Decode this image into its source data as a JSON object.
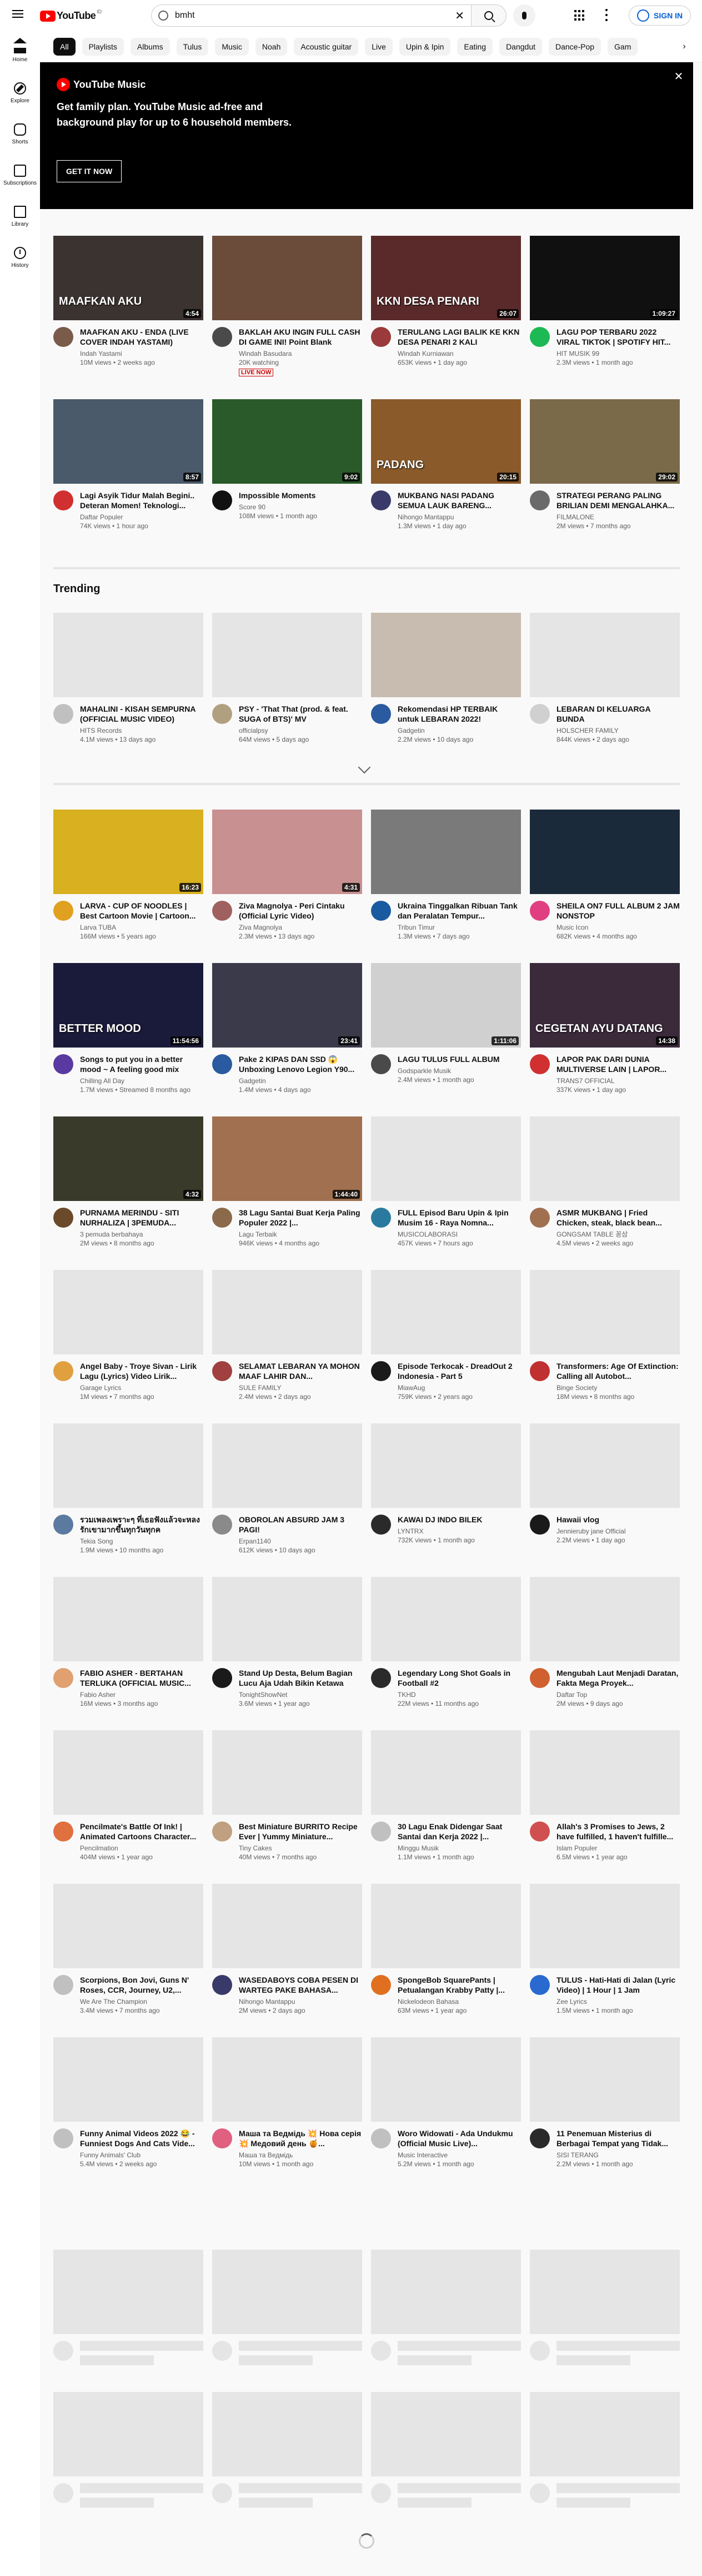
{
  "masthead": {
    "logo_text": "YouTube",
    "logo_country": "ID",
    "search_value": "bmht",
    "sign_in": "SIGN IN"
  },
  "chips": [
    "All",
    "Playlists",
    "Albums",
    "Tulus",
    "Music",
    "Noah",
    "Acoustic guitar",
    "Live",
    "Upin & Ipin",
    "Eating",
    "Dangdut",
    "Dance-Pop",
    "Gam"
  ],
  "sidebar": [
    {
      "label": "Home",
      "icon": "home-icon"
    },
    {
      "label": "Explore",
      "icon": "compass-icon"
    },
    {
      "label": "Shorts",
      "icon": "shorts-icon"
    },
    {
      "label": "Subscriptions",
      "icon": "subscriptions-icon"
    },
    {
      "label": "Library",
      "icon": "library-icon"
    },
    {
      "label": "History",
      "icon": "history-icon"
    }
  ],
  "banner": {
    "brand": "YouTube Music",
    "text": "Get family plan. YouTube Music ad-free and background play for up to 6 household members.",
    "button": "GET IT NOW"
  },
  "trending_title": "Trending",
  "videos_top": [
    {
      "title": "MAAFKAN AKU - ENDA (LIVE COVER INDAH YASTAMI)",
      "channel": "Indah Yastami",
      "stats": "10M views • 2 weeks ago",
      "duration": "4:54",
      "thumb_color": "#3a3330",
      "thumb_text": "MAAFKAN AKU",
      "avatar_color": "#7a5a4a"
    },
    {
      "title": "BAKLAH AKU INGIN FULL CASH DI GAME INI! Point Blank",
      "channel": "Windah Basudara",
      "stats": "20K watching",
      "live": "LIVE NOW",
      "thumb_color": "#6b4b3a",
      "avatar_color": "#4a4a4a"
    },
    {
      "title": "TERULANG LAGI BALIK KE KKN DESA PENARI 2 KALI",
      "channel": "Windah Kurniawan",
      "stats": "653K views • 1 day ago",
      "duration": "26:07",
      "thumb_color": "#5a2a2a",
      "thumb_text": "KKN DESA PENARI",
      "avatar_color": "#9a3a3a"
    },
    {
      "title": "LAGU POP TERBARU 2022 VIRAL TIKTOK | SPOTIFY HIT...",
      "channel": "HIT MUSIK 99",
      "stats": "2.3M views • 1 month ago",
      "duration": "1:09:27",
      "thumb_color": "#101010",
      "avatar_color": "#1db954"
    },
    {
      "title": "Lagi Asyik Tidur Malah Begini.. Deteran Momen! Teknologi...",
      "channel": "Daftar Populer",
      "stats": "74K views • 1 hour ago",
      "duration": "8:57",
      "thumb_color": "#4a5a6a",
      "avatar_color": "#d03030"
    },
    {
      "title": "Impossible Moments",
      "channel": "Score 90",
      "stats": "108M views • 1 month ago",
      "duration": "9:02",
      "thumb_color": "#2a5a2a",
      "avatar_color": "#111111"
    },
    {
      "title": "MUKBANG NASI PADANG SEMUA LAUK BARENG...",
      "channel": "Nihongo Mantappu",
      "stats": "1.3M views • 1 day ago",
      "duration": "20:15",
      "thumb_color": "#8a5a2a",
      "thumb_text": "PADANG",
      "avatar_color": "#3a3a6a"
    },
    {
      "title": "STRATEGI PERANG PALING BRILIAN DEMI MENGALAHKA...",
      "channel": "FILMALONE",
      "stats": "2M views • 7 months ago",
      "duration": "29:02",
      "thumb_color": "#7a6a4a",
      "avatar_color": "#6a6a6a"
    }
  ],
  "videos_trending": [
    {
      "title": "MAHALINI - KISAH SEMPURNA (OFFICIAL MUSIC VIDEO)",
      "channel": "HITS Records",
      "stats": "4.1M views • 13 days ago",
      "thumb_color": "#e5e5e5",
      "avatar_color": "#c0c0c0"
    },
    {
      "title": "PSY - 'That That (prod. & feat. SUGA of BTS)' MV",
      "channel": "officialpsy",
      "stats": "64M views • 5 days ago",
      "thumb_color": "#e5e5e5",
      "avatar_color": "#b0a080"
    },
    {
      "title": "Rekomendasi HP TERBAIK untuk LEBARAN 2022!",
      "channel": "Gadgetin",
      "stats": "2.2M views • 10 days ago",
      "thumb_color": "#c8bcb0",
      "avatar_color": "#2a5aa0"
    },
    {
      "title": "LEBARAN DI KELUARGA BUNDA",
      "channel": "HOLSCHER FAMILY",
      "stats": "844K views • 2 days ago",
      "thumb_color": "#e5e5e5",
      "avatar_color": "#d0d0d0"
    }
  ],
  "videos_more": [
    {
      "title": "LARVA - CUP OF NOODLES | Best Cartoon Movie | Cartoon...",
      "channel": "Larva TUBA",
      "stats": "166M views • 5 years ago",
      "duration": "16:23",
      "thumb_color": "#d8b020",
      "avatar_color": "#e0a020"
    },
    {
      "title": "Ziva Magnolya - Peri Cintaku (Official Lyric Video)",
      "channel": "Ziva Magnolya",
      "stats": "2.3M views • 13 days ago",
      "duration": "4:31",
      "thumb_color": "#c89090",
      "avatar_color": "#a06060"
    },
    {
      "title": "Ukraina Tinggalkan Ribuan Tank dan Peralatan Tempur...",
      "channel": "Tribun Timur",
      "stats": "1.3M views • 7 days ago",
      "thumb_color": "#7a7a7a",
      "avatar_color": "#1a5aa0"
    },
    {
      "title": "SHEILA ON7 FULL ALBUM 2 JAM NONSTOP",
      "channel": "Music Icon",
      "stats": "682K views • 4 months ago",
      "thumb_color": "#1a2a3a",
      "avatar_color": "#e04080"
    },
    {
      "title": "Songs to put you in a better mood ~ A feeling good mix",
      "channel": "Chilling All Day",
      "stats": "1.7M views • Streamed 8 months ago",
      "duration": "11:54:56",
      "thumb_color": "#1a1a3a",
      "thumb_text": "BETTER MOOD",
      "avatar_color": "#5a3aa0"
    },
    {
      "title": "Pake 2 KIPAS DAN SSD 😱 Unboxing Lenovo Legion Y90...",
      "channel": "Gadgetin",
      "stats": "1.4M views • 4 days ago",
      "duration": "23:41",
      "thumb_color": "#3a3a4a",
      "avatar_color": "#2a5aa0"
    },
    {
      "title": "LAGU TULUS FULL ALBUM",
      "channel": "Godsparkle Musik",
      "stats": "2.4M views • 1 month ago",
      "duration": "1:11:06",
      "thumb_color": "#d0d0d0",
      "avatar_color": "#4a4a4a"
    },
    {
      "title": "LAPOR PAK DARI DUNIA MULTIVERSE LAIN | LAPOR...",
      "channel": "TRANS7 OFFICIAL",
      "stats": "337K views • 1 day ago",
      "duration": "14:38",
      "thumb_color": "#3a2a3a",
      "thumb_text": "CEGETAN AYU DATANG",
      "avatar_color": "#d03030"
    },
    {
      "title": "PURNAMA MERINDU - SITI NURHALIZA | 3PEMUDA...",
      "channel": "3 pemuda berbahaya",
      "stats": "2M views • 8 months ago",
      "duration": "4:32",
      "thumb_color": "#3a3a2a",
      "avatar_color": "#6a4a2a"
    },
    {
      "title": "38 Lagu Santai Buat Kerja Paling Populer 2022 |...",
      "channel": "Lagu Terbaik",
      "stats": "946K views • 4 months ago",
      "duration": "1:44:40",
      "thumb_color": "#a07050",
      "avatar_color": "#8a6a4a"
    },
    {
      "title": "FULL Episod Baru Upin & Ipin Musim 16 - Raya Nomna...",
      "channel": "MUSICOLABORASI",
      "stats": "457K views • 7 hours ago",
      "thumb_color": "#e5e5e5",
      "avatar_color": "#2a7aa0"
    },
    {
      "title": "ASMR MUKBANG | Fried Chicken, steak, black bean...",
      "channel": "GONGSAM TABLE 꽁삼",
      "stats": "4.5M views • 2 weeks ago",
      "thumb_color": "#e5e5e5",
      "avatar_color": "#a07050"
    },
    {
      "title": "Angel Baby - Troye Sivan - Lirik Lagu (Lyrics) Video Lirik...",
      "channel": "Garage Lyrics",
      "stats": "1M views • 7 months ago",
      "thumb_color": "#e5e5e5",
      "avatar_color": "#e0a040"
    },
    {
      "title": "SELAMAT LEBARAN YA MOHON MAAF LAHIR DAN...",
      "channel": "SULE FAMILY",
      "stats": "2.4M views • 2 days ago",
      "thumb_color": "#e5e5e5",
      "avatar_color": "#a04040"
    },
    {
      "title": "Episode Terkocak - DreadOut 2 Indonesia - Part 5",
      "channel": "MiawAug",
      "stats": "759K views • 2 years ago",
      "thumb_color": "#e5e5e5",
      "avatar_color": "#1a1a1a"
    },
    {
      "title": "Transformers: Age Of Extinction: Calling all Autobot...",
      "channel": "Binge Society",
      "stats": "18M views • 8 months ago",
      "thumb_color": "#e5e5e5",
      "avatar_color": "#c03030"
    },
    {
      "title": "รวมเพลงเพราะๆ ที่เธอฟังแล้วจะหลงรักเขามากขึ้นทุกวันทุกค",
      "channel": "Tekia Song",
      "stats": "1.9M views • 10 months ago",
      "thumb_color": "#e5e5e5",
      "avatar_color": "#5a7aa0"
    },
    {
      "title": "OBOROLAN ABSURD JAM 3 PAGI!",
      "channel": "Erpan1140",
      "stats": "612K views • 10 days ago",
      "thumb_color": "#e5e5e5",
      "avatar_color": "#8a8a8a"
    },
    {
      "title": "KAWAI DJ INDO BILEK",
      "channel": "LYNTRX",
      "stats": "732K views • 1 month ago",
      "thumb_color": "#e5e5e5",
      "avatar_color": "#2a2a2a"
    },
    {
      "title": "Hawaii vlog",
      "channel": "Jennieruby jane Official",
      "stats": "2.2M views • 1 day ago",
      "thumb_color": "#e5e5e5",
      "avatar_color": "#1a1a1a"
    },
    {
      "title": "FABIO ASHER - BERTAHAN TERLUKA (OFFICIAL MUSIC...",
      "channel": "Fabio Asher",
      "stats": "16M views • 3 months ago",
      "thumb_color": "#e5e5e5",
      "avatar_color": "#e0a070"
    },
    {
      "title": "Stand Up Desta, Belum Bagian Lucu Aja Udah Bikin Ketawa",
      "channel": "TonightShowNet",
      "stats": "3.6M views • 1 year ago",
      "thumb_color": "#e5e5e5",
      "avatar_color": "#1a1a1a"
    },
    {
      "title": "Legendary Long Shot Goals in Football #2",
      "channel": "TKHD",
      "stats": "22M views • 11 months ago",
      "thumb_color": "#e5e5e5",
      "avatar_color": "#2a2a2a"
    },
    {
      "title": "Mengubah Laut Menjadi Daratan, Fakta Mega Proyek...",
      "channel": "Daftar Top",
      "stats": "2M views • 9 days ago",
      "thumb_color": "#e5e5e5",
      "avatar_color": "#d06030"
    },
    {
      "title": "Pencilmate's Battle Of Ink! | Animated Cartoons Character...",
      "channel": "Pencilmation",
      "stats": "404M views • 1 year ago",
      "thumb_color": "#e5e5e5",
      "avatar_color": "#e07040"
    },
    {
      "title": "Best Miniature BURRITO Recipe Ever | Yummy Miniature...",
      "channel": "Tiny Cakes",
      "stats": "40M views • 7 months ago",
      "thumb_color": "#e5e5e5",
      "avatar_color": "#c0a080"
    },
    {
      "title": "30 Lagu Enak Didengar Saat Santai dan Kerja 2022 |...",
      "channel": "Minggu Musik",
      "stats": "1.1M views • 1 month ago",
      "thumb_color": "#e5e5e5",
      "avatar_color": "#c0c0c0"
    },
    {
      "title": "Allah's 3 Promises to Jews, 2 have fulfilled, 1 haven't fulfille...",
      "channel": "Islam Populer",
      "stats": "6.5M views • 1 year ago",
      "thumb_color": "#e5e5e5",
      "avatar_color": "#d05050"
    },
    {
      "title": "Scorpions, Bon Jovi, Guns N' Roses, CCR, Journey, U2,...",
      "channel": "We Are The Champion",
      "stats": "3.4M views • 7 months ago",
      "thumb_color": "#e5e5e5",
      "avatar_color": "#c0c0c0"
    },
    {
      "title": "WASEDABOYS COBA PESEN DI WARTEG PAKE BAHASA...",
      "channel": "Nihongo Mantappu",
      "stats": "2M views • 2 days ago",
      "thumb_color": "#e5e5e5",
      "avatar_color": "#3a3a6a"
    },
    {
      "title": "SpongeBob SquarePants | Petualangan Krabby Patty |...",
      "channel": "Nickelodeon Bahasa",
      "stats": "63M views • 1 year ago",
      "thumb_color": "#e5e5e5",
      "avatar_color": "#e07020"
    },
    {
      "title": "TULUS - Hati-Hati di Jalan (Lyric Video) | 1 Hour | 1 Jam",
      "channel": "Zee Lyrics",
      "stats": "1.5M views • 1 month ago",
      "thumb_color": "#e5e5e5",
      "avatar_color": "#2a6ad0"
    },
    {
      "title": "Funny Animal Videos 2022 😂 - Funniest Dogs And Cats Vide...",
      "channel": "Funny Animals' Club",
      "stats": "5.4M views • 2 weeks ago",
      "thumb_color": "#e5e5e5",
      "avatar_color": "#c0c0c0"
    },
    {
      "title": "Маша та Ведмідь 💥 Нова серія 💥 Медовий день 🍯...",
      "channel": "Маша та Ведмідь",
      "stats": "10M views • 1 month ago",
      "thumb_color": "#e5e5e5",
      "avatar_color": "#e06080"
    },
    {
      "title": "Woro Widowati - Ada Undukmu (Official Music Live)...",
      "channel": "Music Interactive",
      "stats": "5.2M views • 1 month ago",
      "thumb_color": "#e5e5e5",
      "avatar_color": "#c0c0c0"
    },
    {
      "title": "11 Penemuan Misterius di Berbagai Tempat yang Tidak...",
      "channel": "SISI TERANG",
      "stats": "2.2M views • 1 month ago",
      "thumb_color": "#e5e5e5",
      "avatar_color": "#2a2a2a"
    }
  ]
}
